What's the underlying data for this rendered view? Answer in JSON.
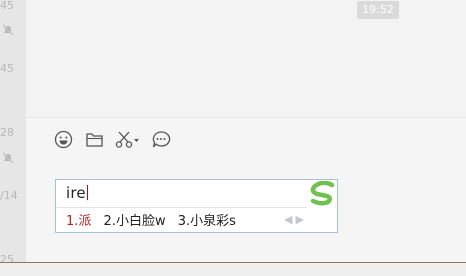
{
  "conversation_list": {
    "times": [
      "45",
      "45",
      "28",
      "/14",
      "25"
    ]
  },
  "chat": {
    "timestamp": "19:52"
  },
  "toolbar": {
    "icons": [
      "emoji-icon",
      "folder-icon",
      "scissors-icon",
      "chat-history-icon"
    ]
  },
  "ime": {
    "composition": "ire",
    "candidates": [
      "1.派",
      "2.小白脸w",
      "3.小泉彩s"
    ],
    "logo_color": "#6cc24a",
    "selected_color": "#c81e1e"
  }
}
